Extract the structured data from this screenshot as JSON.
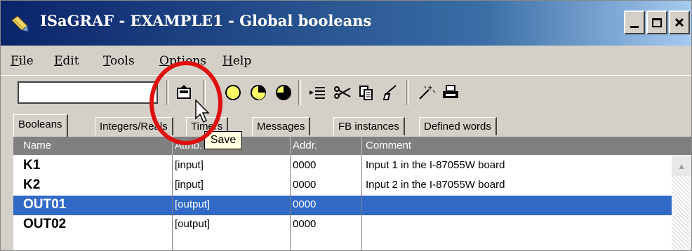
{
  "window": {
    "title": "ISaGRAF - EXAMPLE1 - Global booleans",
    "minimize_label": "_",
    "maximize_label": "□",
    "close_label": "×"
  },
  "menu": {
    "items": [
      {
        "prefix": "",
        "accel": "F",
        "rest": "ile"
      },
      {
        "prefix": "",
        "accel": "E",
        "rest": "dit"
      },
      {
        "prefix": "",
        "accel": "T",
        "rest": "ools"
      },
      {
        "prefix": "",
        "accel": "O",
        "rest": "ptions"
      },
      {
        "prefix": "",
        "accel": "H",
        "rest": "elp"
      }
    ]
  },
  "toolbar": {
    "search_value": "",
    "icons": [
      "save-icon",
      "circle-empty-icon",
      "circle-half-icon",
      "circle-clock-icon",
      "indent-icon",
      "scissors-icon",
      "copy-icon",
      "paste-icon",
      "wand-icon",
      "print-icon"
    ]
  },
  "tabs": [
    "Booleans",
    "Integers/Reals",
    "Timers",
    "Messages",
    "FB instances",
    "Defined words"
  ],
  "tooltip": "Save",
  "table": {
    "columns": [
      "Name",
      "Attrib.",
      "Addr.",
      "Comment"
    ],
    "rows": [
      {
        "name": "K1",
        "attr": "[input]",
        "addr": "0000",
        "comment": "Input 1 in the I-87055W board",
        "selected": false
      },
      {
        "name": "K2",
        "attr": "[input]",
        "addr": "0000",
        "comment": "Input 2 in the I-87055W board",
        "selected": false
      },
      {
        "name": "OUT01",
        "attr": "[output]",
        "addr": "0000",
        "comment": "",
        "selected": true
      },
      {
        "name": "OUT02",
        "attr": "[output]",
        "addr": "0000",
        "comment": "",
        "selected": false
      }
    ]
  },
  "colors": {
    "title_bar": "#0a246a",
    "selection": "#3169c6",
    "highlight_ring": "#e01010"
  }
}
